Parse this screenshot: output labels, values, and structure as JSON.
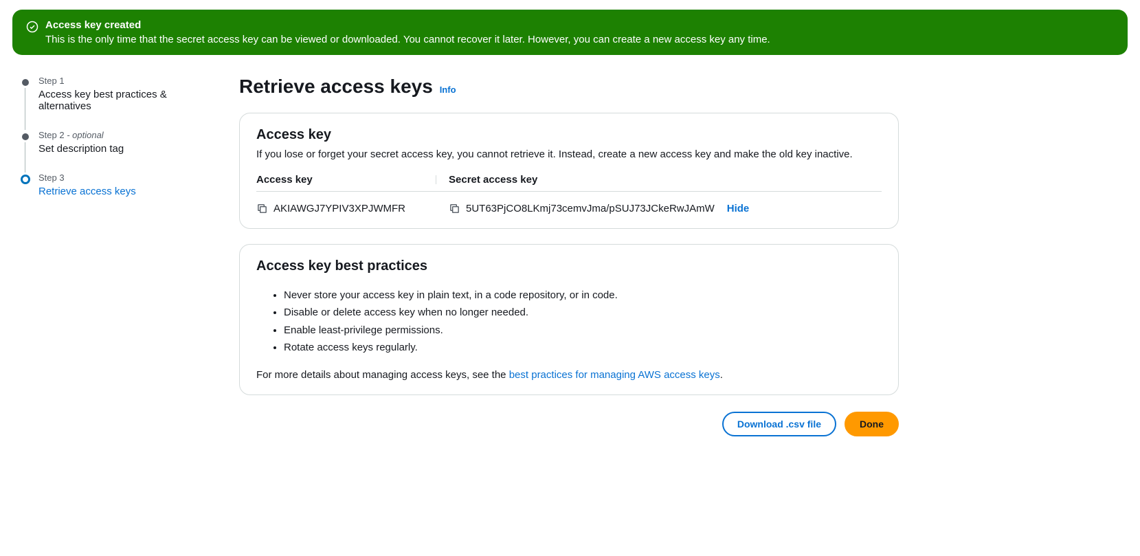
{
  "banner": {
    "title": "Access key created",
    "message": "This is the only time that the secret access key can be viewed or downloaded. You cannot recover it later. However, you can create a new access key any time."
  },
  "wizard": {
    "steps": [
      {
        "label": "Step 1",
        "optional": "",
        "title": "Access key best practices & alternatives"
      },
      {
        "label": "Step 2",
        "optional": " - optional",
        "title": "Set description tag"
      },
      {
        "label": "Step 3",
        "optional": "",
        "title": "Retrieve access keys"
      }
    ]
  },
  "page": {
    "title": "Retrieve access keys",
    "info": "Info"
  },
  "access_key": {
    "heading": "Access key",
    "description": "If you lose or forget your secret access key, you cannot retrieve it. Instead, create a new access key and make the old key inactive.",
    "col1_label": "Access key",
    "col2_label": "Secret access key",
    "access_key_value": "AKIAWGJ7YPIV3XPJWMFR",
    "secret_value": "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",
    "hide_label": "Hide"
  },
  "best_practices": {
    "heading": "Access key best practices",
    "items": [
      "Never store your access key in plain text, in a code repository, or in code.",
      "Disable or delete access key when no longer needed.",
      "Enable least-privilege permissions.",
      "Rotate access keys regularly."
    ],
    "footer_prefix": "For more details about managing access keys, see the ",
    "footer_link": "best practices for managing AWS access keys",
    "footer_suffix": "."
  },
  "actions": {
    "download": "Download .csv file",
    "done": "Done"
  }
}
